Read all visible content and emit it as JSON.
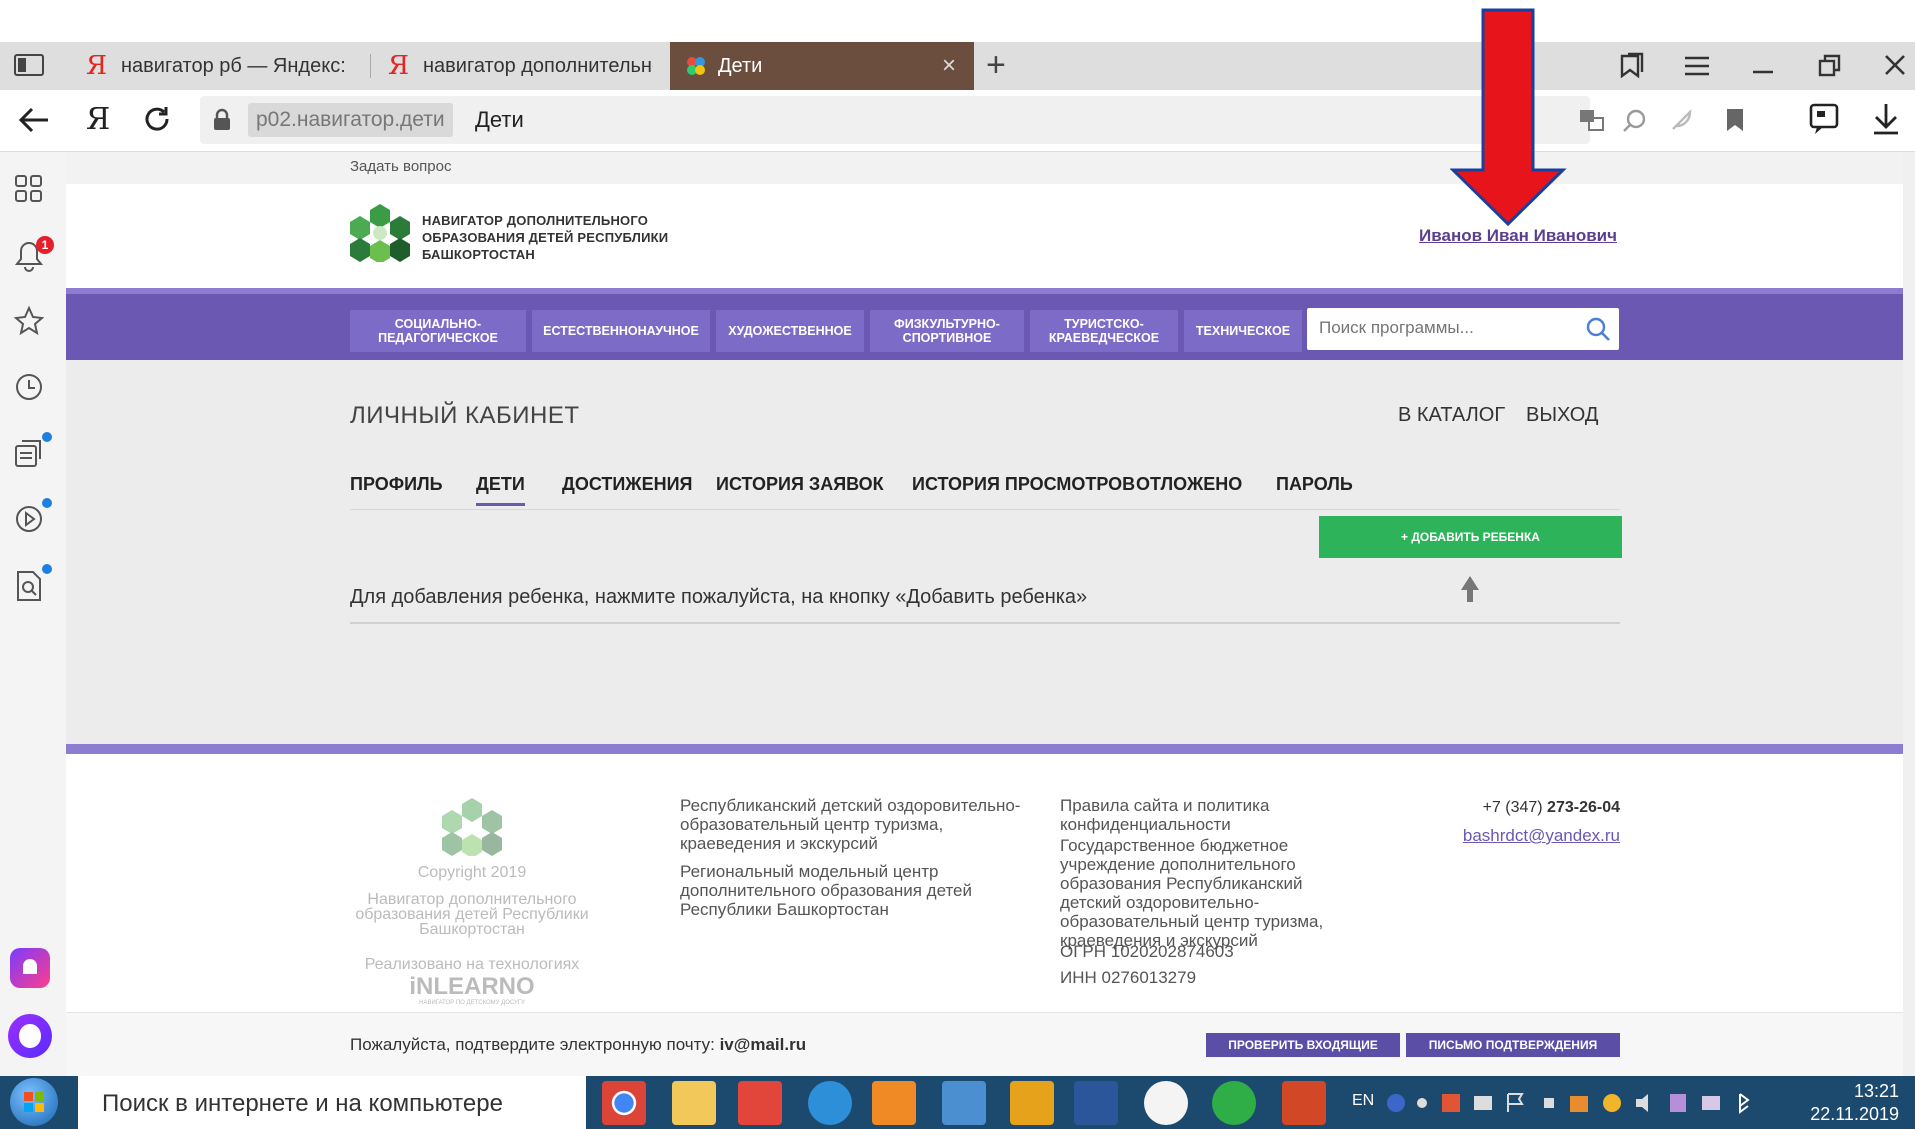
{
  "browser": {
    "tabs": [
      {
        "label": "навигатор рб — Яндекс: на",
        "icon": "yandex-icon"
      },
      {
        "label": "навигатор дополнительного",
        "icon": "yandex-icon"
      },
      {
        "label": "Дети",
        "icon": "site-favicon",
        "close": "×"
      }
    ],
    "new_tab": "+",
    "host": "p02.навигатор.дети",
    "page_title": "Дети",
    "yandex_letter": "Я",
    "notification_count": "1"
  },
  "site": {
    "ask_question": "Задать вопрос",
    "logo_text": "НАВИГАТОР ДОПОЛНИТЕЛЬНОГО ОБРАЗОВАНИЯ ДЕТЕЙ РЕСПУБЛИКИ БАШКОРТОСТАН",
    "user_name": "Иванов Иван Иванович",
    "categories": [
      "СОЦИАЛЬНО-ПЕДАГОГИЧЕСКОЕ",
      "ЕСТЕСТВЕННОНАУЧНОЕ",
      "ХУДОЖЕСТВЕННОЕ",
      "ФИЗКУЛЬТУРНО-СПОРТИВНОЕ",
      "ТУРИСТСКО-КРАЕВЕДЧЕСКОЕ",
      "ТЕХНИЧЕСКОЕ"
    ],
    "search_placeholder": "Поиск программы..."
  },
  "cabinet": {
    "title": "ЛИЧНЫЙ КАБИНЕТ",
    "to_catalog": "В КАТАЛОГ",
    "logout": "ВЫХОД",
    "tabs": [
      "ПРОФИЛЬ",
      "ДЕТИ",
      "ДОСТИЖЕНИЯ",
      "ИСТОРИЯ ЗАЯВОК",
      "ИСТОРИЯ ПРОСМОТРОВ",
      "ОТЛОЖЕНО",
      "ПАРОЛЬ"
    ],
    "active_tab": "ДЕТИ",
    "add_child": "+ ДОБАВИТЬ РЕБЕНКА",
    "hint": "Для добавления ребенка, нажмите пожалуйста, на кнопку «Добавить ребенка»"
  },
  "footer": {
    "copyright": "Copyright 2019",
    "org_name": "Навигатор дополнительного образования детей Республики Башкортостан",
    "tech_label": "Реализовано на технологиях",
    "tech_brand": "iNLEARNO",
    "tech_sub": "НАВИГАТОР ПО ДЕТСКОМУ ДОСУГУ",
    "col2": [
      "Республиканский детский оздоровительно-образовательный центр туризма, краеведения и экскурсий",
      "Региональный модельный центр дополнительного образования детей Республики Башкортостан"
    ],
    "col3": {
      "policy": "Правила сайта и политика конфиденциальности",
      "org": "Государственное бюджетное учреждение дополнительного образования Республиканский детский оздоровительно-образовательный центр туризма, краеведения и экскурсий",
      "ogrn": "ОГРН 1020202874603",
      "inn": "ИНН 0276013279"
    },
    "phone_prefix": "+7 (347) ",
    "phone_number": "273-26-04",
    "email": "bashrdct@yandex.ru"
  },
  "email_bar": {
    "text": "Пожалуйста, подтвердите электронную почту: ",
    "email": "iv@mail.ru",
    "check_inbox": "ПРОВЕРИТЬ ВХОДЯЩИЕ",
    "resend": "ПИСЬМО ПОДТВЕРЖДЕНИЯ"
  },
  "taskbar": {
    "search": "Поиск в интернете и на компьютере",
    "lang": "EN",
    "time": "13:21",
    "date": "22.11.2019"
  },
  "colors": {
    "menu_purple": "#6b58b2",
    "add_green": "#2db45a",
    "arrow_red": "#e8141c",
    "user_link": "#5b3f8e"
  }
}
